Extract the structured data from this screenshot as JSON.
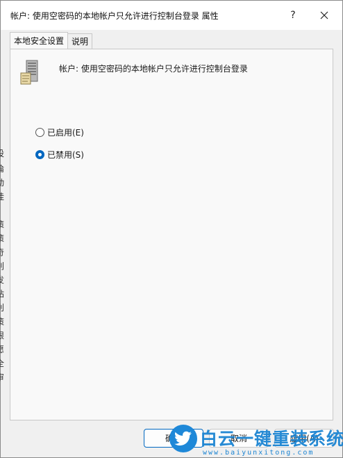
{
  "window": {
    "title": "帐户: 使用空密码的本地帐户只允许进行控制台登录 属性",
    "help_label": "?",
    "close_icon": "close-icon"
  },
  "tabs": [
    {
      "label": "本地安全设置",
      "active": true
    },
    {
      "label": "说明",
      "active": false
    }
  ],
  "policy": {
    "icon": "server-policy-icon",
    "name": "帐户: 使用空密码的本地帐户只允许进行控制台登录"
  },
  "options": [
    {
      "label": "已启用(E)",
      "checked": false
    },
    {
      "label": "已禁用(S)",
      "checked": true
    }
  ],
  "buttons": {
    "ok": "确定",
    "cancel": "取消",
    "apply": "应用(A)"
  },
  "background_text": [
    "设",
    "倫",
    "动",
    "挂",
    "I",
    "策",
    "策",
    "奇",
    "刖",
    "发",
    "站",
    "刈",
    "策",
    "限",
    "愿",
    "全",
    "审"
  ],
  "watermark": {
    "brand": "白云一键重装系统",
    "url": "www.baiyunxitong.com"
  },
  "colors": {
    "accent": "#0067c0",
    "watermark": "#1b84d2"
  }
}
